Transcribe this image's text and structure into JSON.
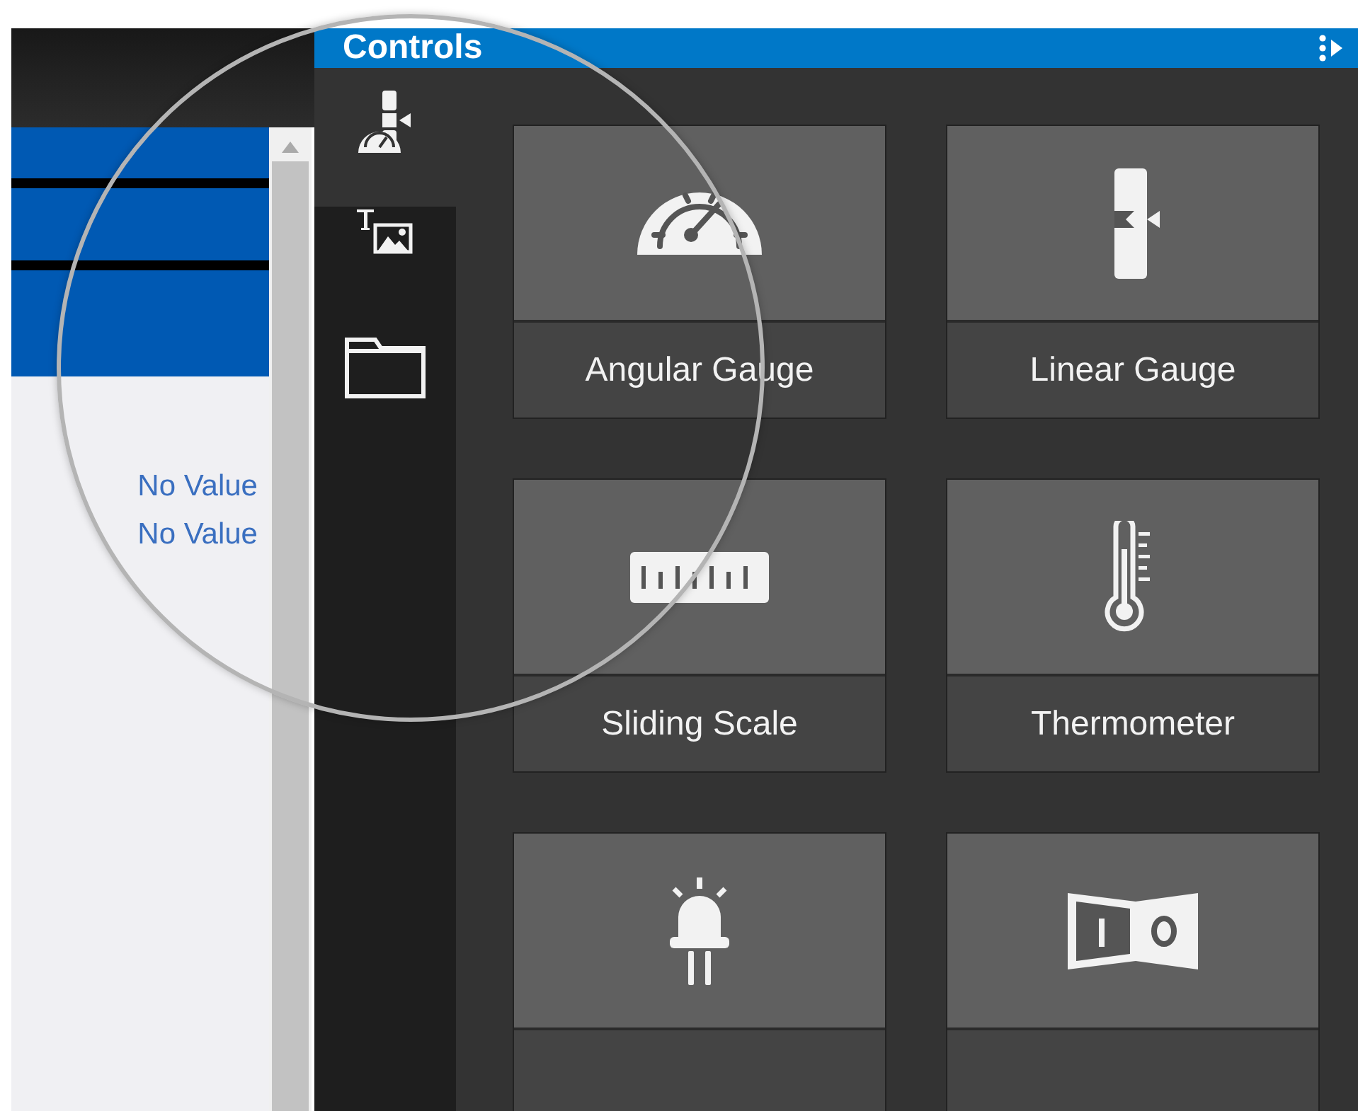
{
  "left_panel": {
    "values": [
      "No Value",
      "No Value"
    ]
  },
  "controls_panel": {
    "title": "Controls",
    "rail": [
      {
        "kind": "gauges",
        "selected": true
      },
      {
        "kind": "text-image",
        "selected": false
      },
      {
        "kind": "folder",
        "selected": false
      }
    ],
    "tiles": [
      {
        "kind": "angular",
        "label": "Angular Gauge"
      },
      {
        "kind": "linear",
        "label": "Linear Gauge"
      },
      {
        "kind": "sliding",
        "label": "Sliding Scale"
      },
      {
        "kind": "thermometer",
        "label": "Thermometer"
      },
      {
        "kind": "led"
      },
      {
        "kind": "switch"
      }
    ]
  }
}
